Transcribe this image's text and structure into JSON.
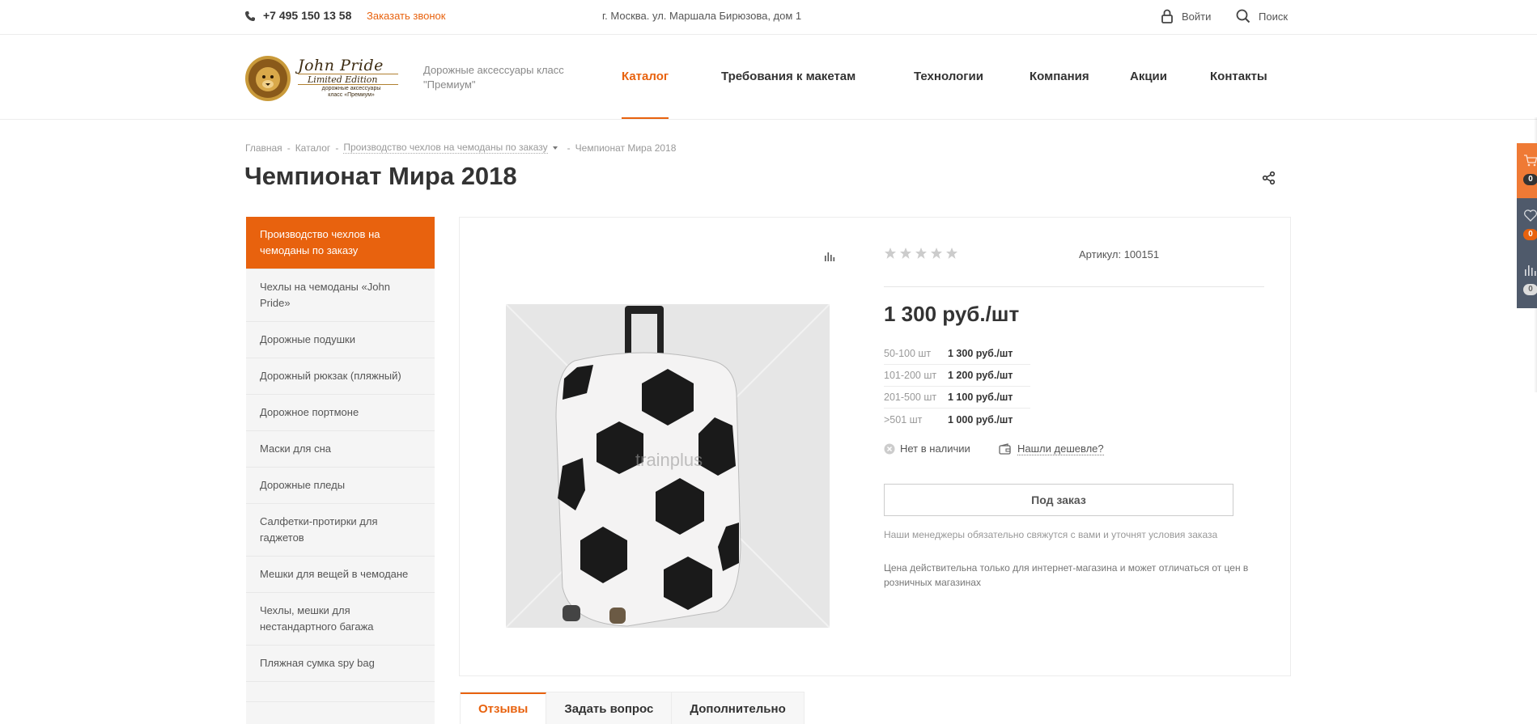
{
  "topbar": {
    "phone": "+7 495 150 13 58",
    "callback": "Заказать звонок",
    "address": "г. Москва. ул. Маршала Бирюзова, дом 1",
    "login": "Войти",
    "search": "Поиск"
  },
  "header": {
    "logo_line1": "John Pride",
    "logo_line2": "Limited Edition",
    "logo_line3": "дорожные аксессуары класс «Премиум»",
    "tagline": "Дорожные аксессуары класс \"Премиум\"",
    "nav": [
      "Каталог",
      "Требования к макетам",
      "Технологии",
      "Компания",
      "Акции",
      "Контакты"
    ],
    "active_nav": "Каталог"
  },
  "breadcrumb": {
    "items": [
      "Главная",
      "Каталог",
      "Производство чехлов на чемоданы по заказу",
      "Чемпионат Мира 2018"
    ],
    "separator": "-"
  },
  "page": {
    "title": "Чемпионат Мира 2018"
  },
  "sidebar": {
    "items": [
      "Производство чехлов на чемоданы по заказу",
      "Чехлы на чемоданы «John Pride»",
      "Дорожные подушки",
      "Дорожный рюкзак (пляжный)",
      "Дорожное портмоне",
      "Маски для сна",
      "Дорожные пледы",
      "Салфетки-протирки для гаджетов",
      "Мешки для вещей в чемодане",
      "Чехлы, мешки для нестандартного багажа",
      "Пляжная сумка spy bag"
    ],
    "active_index": 0
  },
  "product": {
    "article_label": "Артикул: 100151",
    "rating_stars": 5,
    "rating_value": 0,
    "watermark": "trainplus",
    "price": "1 300 руб./шт",
    "price_tiers": [
      {
        "qty": "50-100 шт",
        "price": "1 300 руб./шт"
      },
      {
        "qty": "101-200 шт",
        "price": "1 200 руб./шт"
      },
      {
        "qty": "201-500 шт",
        "price": "1 100 руб./шт"
      },
      {
        "qty": ">501 шт",
        "price": "1 000 руб./шт"
      }
    ],
    "availability": "Нет в наличии",
    "cheaper": "Нашли дешевле?",
    "order_button": "Под заказ",
    "note_manager": "Наши менеджеры обязательно свяжутся с вами и уточнят условия заказа",
    "note_price": "Цена действительна только для интернет-магазина и может отличаться от цен в розничных магазинах"
  },
  "tabs": [
    "Отзывы",
    "Задать вопрос",
    "Дополнительно"
  ],
  "right_panel": {
    "cart_count": "0",
    "favorites_count": "0",
    "compare_count": "0"
  },
  "colors": {
    "accent": "#e8620e",
    "panel_dark": "#4f5a6b",
    "panel_cart": "#ef7a35"
  }
}
